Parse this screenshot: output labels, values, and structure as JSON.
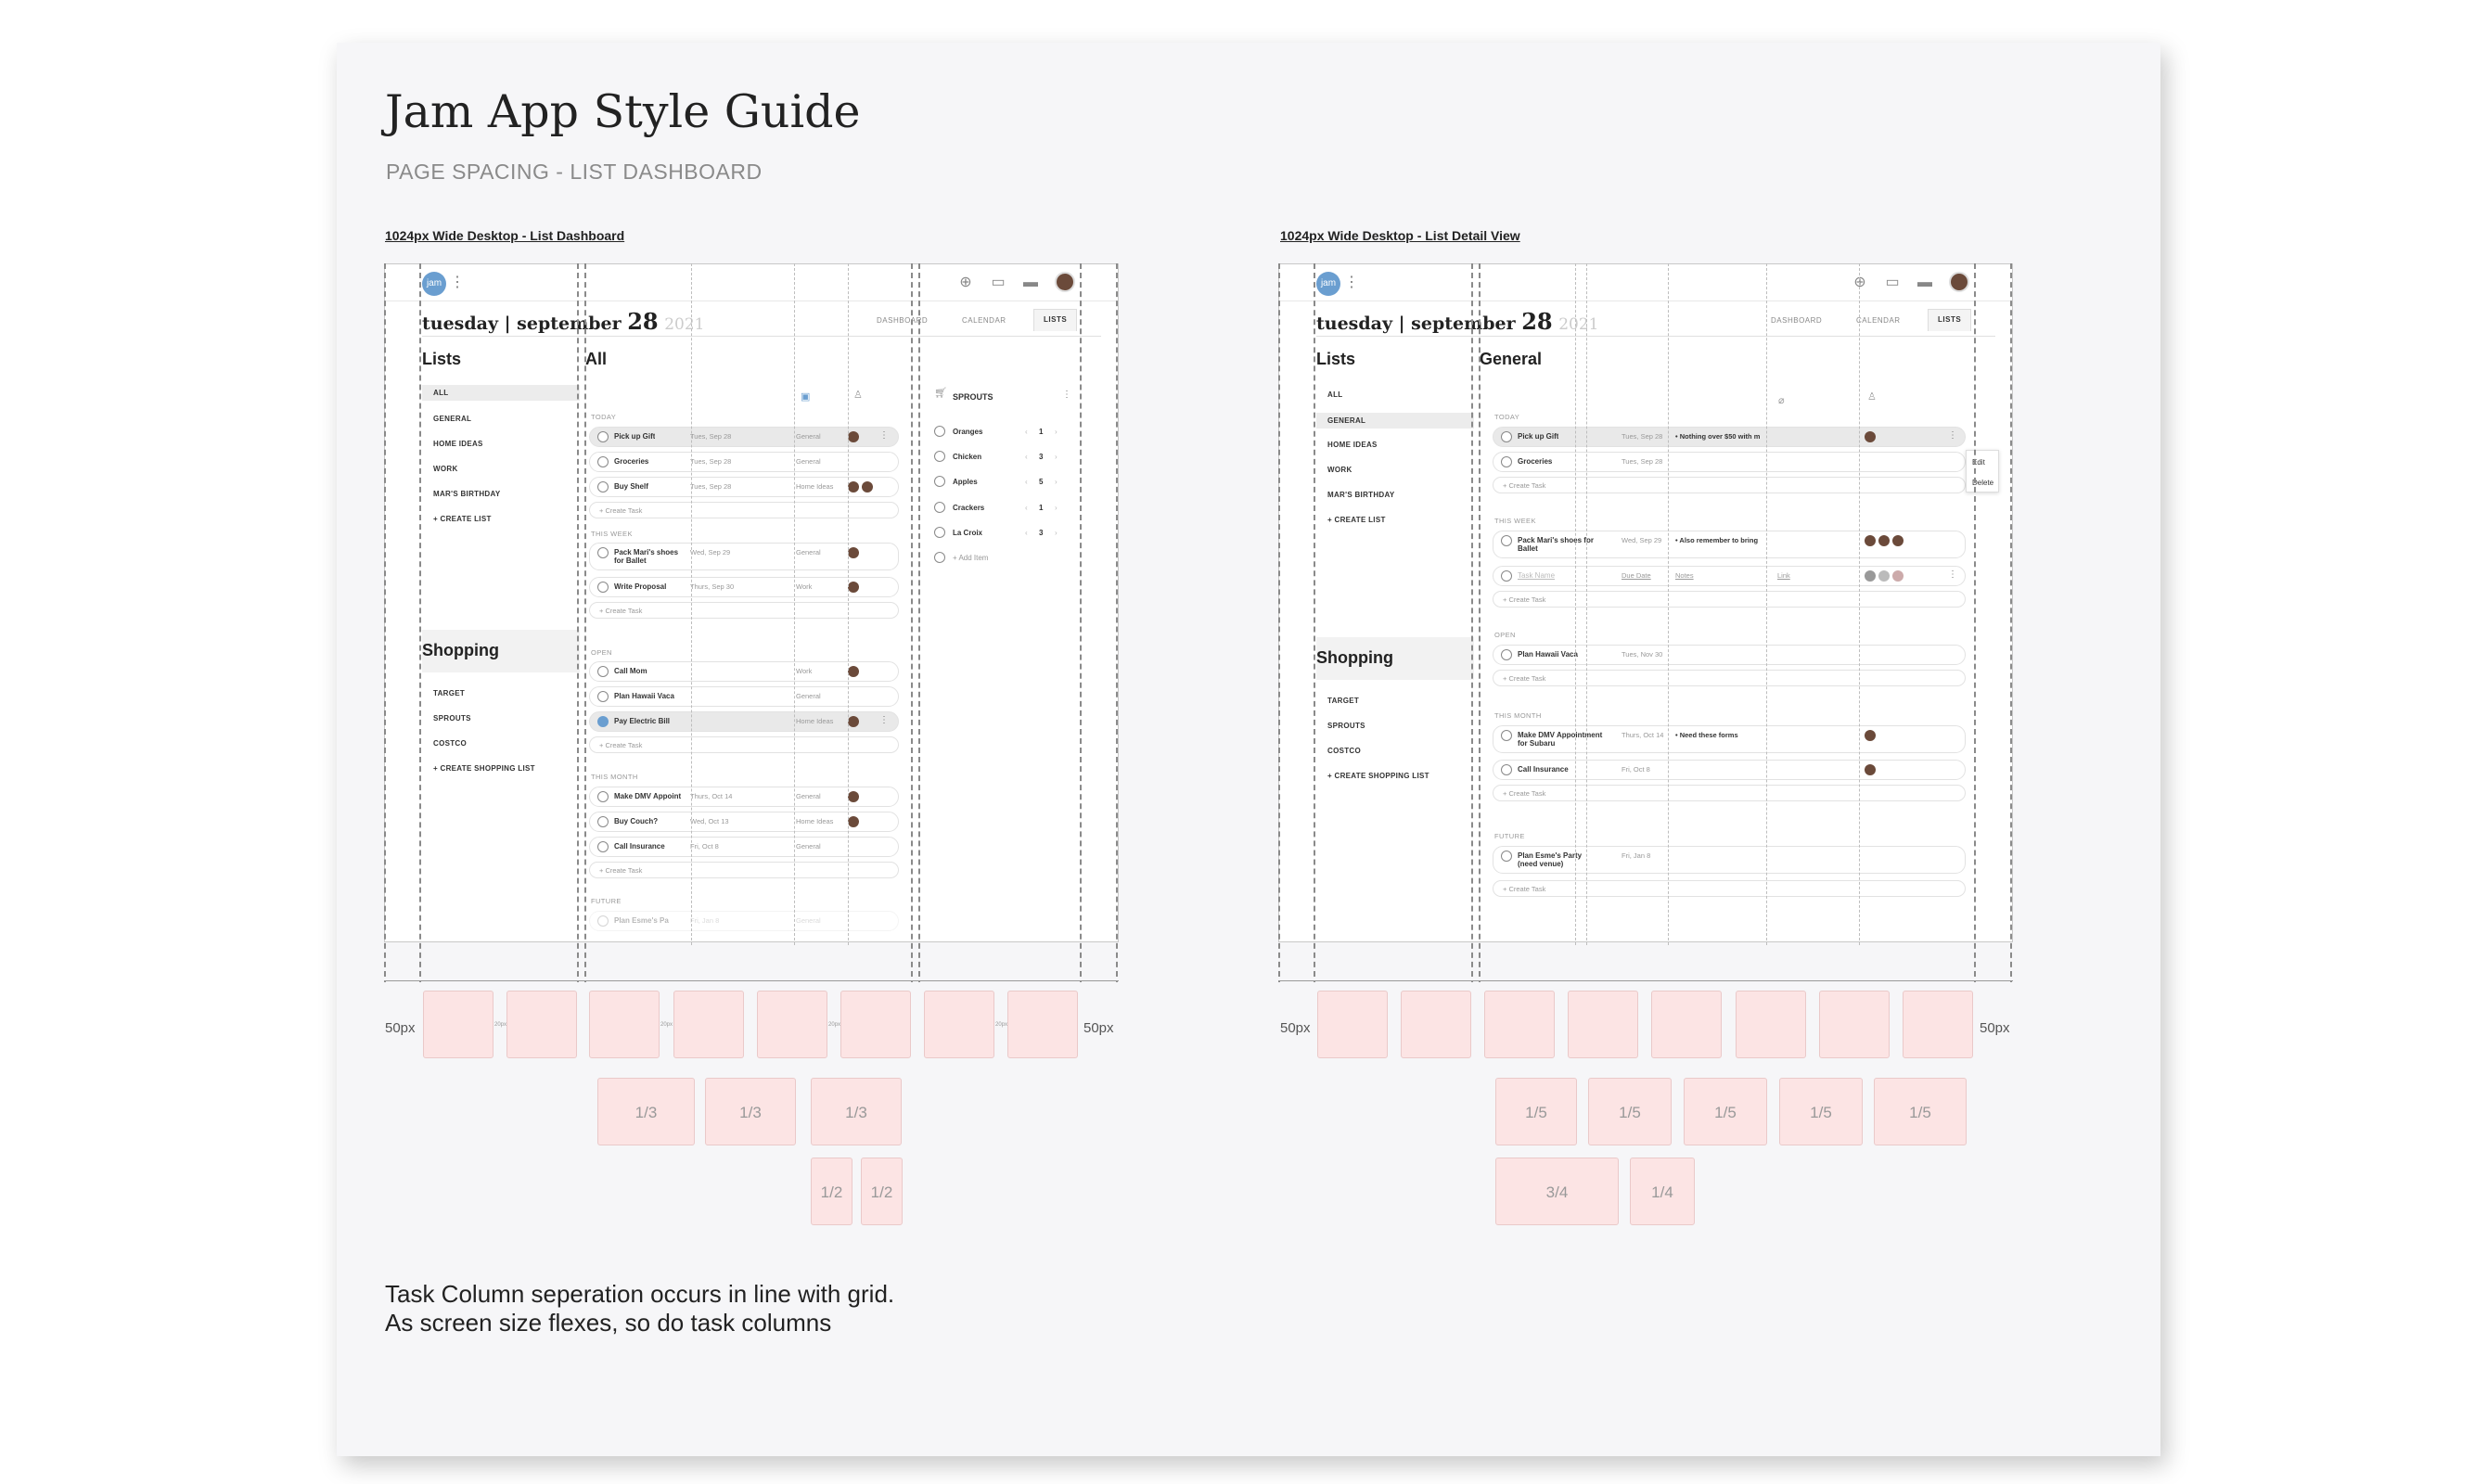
{
  "doc": {
    "title": "Jam App Style Guide",
    "subtitle": "PAGE SPACING - LIST DASHBOARD",
    "footnote": "Task Column seperation occurs in line with grid.\nAs screen size flexes, so do task columns"
  },
  "left": {
    "caption": "1024px Wide Desktop - List Dashboard",
    "logo": "jam",
    "date_main": "tuesday | september ",
    "date_day": "28",
    "date_year": "2021",
    "nav": [
      "DASHBOARD",
      "CALENDAR",
      "LISTS"
    ],
    "lists_title": "Lists",
    "lists": [
      "ALL",
      "GENERAL",
      "HOME IDEAS",
      "WORK",
      "MAR'S BIRTHDAY",
      "+ CREATE LIST"
    ],
    "shopping_title": "Shopping",
    "shopping": [
      "TARGET",
      "SPROUTS",
      "COSTCO",
      "+ CREATE SHOPPING LIST"
    ],
    "main_title": "All",
    "groups": {
      "today": "TODAY",
      "week": "THIS WEEK",
      "open": "OPEN",
      "month": "THIS MONTH",
      "future": "FUTURE"
    },
    "create_task": "+ Create Task",
    "tasks": {
      "t1": {
        "name": "Pick up Gift",
        "date": "Tues, Sep 28",
        "list": "General"
      },
      "t2": {
        "name": "Groceries",
        "date": "Tues, Sep 28",
        "list": "General"
      },
      "t3": {
        "name": "Buy Shelf",
        "date": "Tues, Sep 28",
        "list": "Home Ideas"
      },
      "w1": {
        "name": "Pack Mari's shoes for Ballet",
        "date": "Wed, Sep 29",
        "list": "General"
      },
      "w2": {
        "name": "Write Proposal",
        "date": "Thurs, Sep 30",
        "list": "Work"
      },
      "o1": {
        "name": "Call Mom",
        "date": "",
        "list": "Work"
      },
      "o2": {
        "name": "Plan Hawaii Vaca",
        "date": "",
        "list": "General"
      },
      "o3": {
        "name": "Pay Electric Bill",
        "date": "",
        "list": "Home Ideas"
      },
      "m1": {
        "name": "Make DMV Appoint",
        "date": "Thurs, Oct 14",
        "list": "General"
      },
      "m2": {
        "name": "Buy Couch?",
        "date": "Wed, Oct 13",
        "list": "Home Ideas"
      },
      "m3": {
        "name": "Call Insurance",
        "date": "Fri, Oct 8",
        "list": "General"
      },
      "f1": {
        "name": "Plan Esme's Pa",
        "date": "Fri, Jan 8",
        "list": "General"
      }
    },
    "store_title": "SPROUTS",
    "items": [
      {
        "name": "Oranges",
        "qty": "1"
      },
      {
        "name": "Chicken",
        "qty": "3"
      },
      {
        "name": "Apples",
        "qty": "5"
      },
      {
        "name": "Crackers",
        "qty": "1"
      },
      {
        "name": "La Croix",
        "qty": "3"
      }
    ],
    "add_item": "+ Add Item",
    "margin_label": "50px",
    "thirds": [
      "1/3",
      "1/3",
      "1/3"
    ],
    "halves": [
      "1/2",
      "1/2"
    ]
  },
  "right": {
    "caption": "1024px Wide Desktop - List Detail View",
    "logo": "jam",
    "date_main": "tuesday | september ",
    "date_day": "28",
    "date_year": "2021",
    "nav": [
      "DASHBOARD",
      "CALENDAR",
      "LISTS"
    ],
    "lists_title": "Lists",
    "lists": [
      "ALL",
      "GENERAL",
      "HOME IDEAS",
      "WORK",
      "MAR'S BIRTHDAY",
      "+ CREATE LIST"
    ],
    "shopping_title": "Shopping",
    "shopping": [
      "TARGET",
      "SPROUTS",
      "COSTCO",
      "+ CREATE SHOPPING LIST"
    ],
    "main_title": "General",
    "groups": {
      "today": "TODAY",
      "week": "THIS WEEK",
      "open": "OPEN",
      "month": "THIS MONTH",
      "future": "FUTURE"
    },
    "create_task": "+ Create Task",
    "tasks": {
      "t1": {
        "name": "Pick up Gift",
        "date": "Tues, Sep 28",
        "note": "• Nothing over $50 with m"
      },
      "t2": {
        "name": "Groceries",
        "date": "Tues, Sep 28"
      },
      "w1": {
        "name": "Pack Mari's shoes for Ballet",
        "date": "Wed, Sep 29",
        "note": "• Also remember to bring"
      },
      "w2": {
        "name": "Task Name",
        "date": "Due Date",
        "note": "Notes",
        "link": "Link"
      },
      "o1": {
        "name": "Plan Hawaii Vaca",
        "date": "Tues, Nov 30"
      },
      "m1": {
        "name": "Make DMV Appointment for Subaru",
        "date": "Thurs, Oct 14",
        "note": "• Need these forms"
      },
      "m2": {
        "name": "Call Insurance",
        "date": "Fri, Oct 8"
      },
      "f1": {
        "name": "Plan Esme's Party (need venue)",
        "date": "Fri, Jan 8"
      }
    },
    "menu": [
      "Edit",
      "Delete"
    ],
    "margin_label": "50px",
    "fifths": [
      "1/5",
      "1/5",
      "1/5",
      "1/5",
      "1/5"
    ],
    "three_quarter": "3/4",
    "quarter": "1/4"
  },
  "gutter_label": "20px",
  "colors": {
    "accent": "#6a9ed0",
    "grid_column": "#fce4e4",
    "background": "#f6f6f8"
  }
}
